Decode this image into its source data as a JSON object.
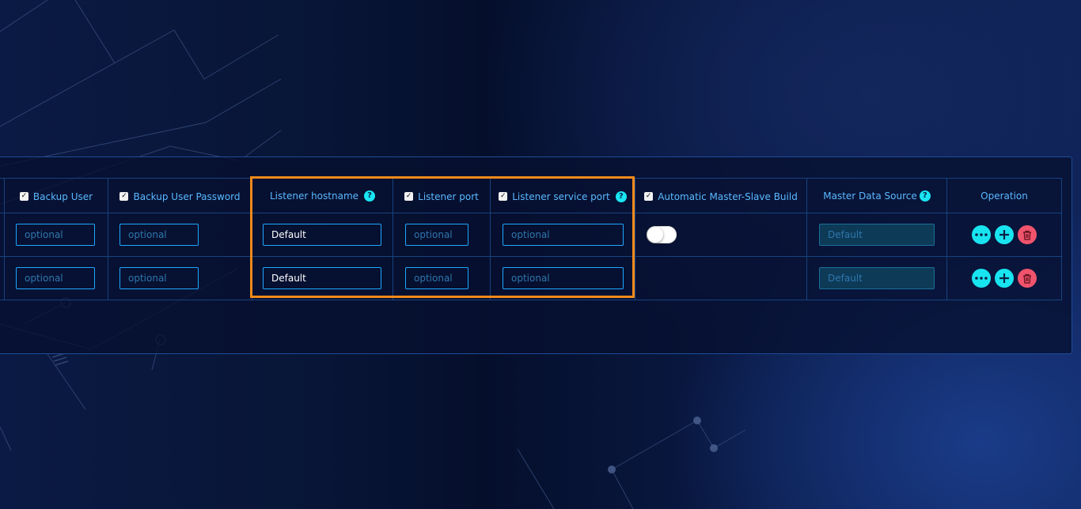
{
  "columns": [
    {
      "label": "Backup User",
      "checked": true
    },
    {
      "label": "Backup User Password",
      "checked": true
    },
    {
      "label": "Listener hostname",
      "help": true
    },
    {
      "label": "Listener port",
      "checked": true
    },
    {
      "label": "Listener service port",
      "checked": true,
      "help": true
    },
    {
      "label": "Automatic Master-Slave Build",
      "checked": true
    },
    {
      "label": "Master Data Source",
      "help": true
    },
    {
      "label": "Operation"
    }
  ],
  "rows": [
    {
      "backup_user_placeholder": "optional",
      "backup_password_placeholder": "optional",
      "listener_hostname": "Default",
      "listener_port_placeholder": "optional",
      "listener_service_port_placeholder": "optional",
      "auto_master_slave": false,
      "master_data_source_placeholder": "Default"
    },
    {
      "backup_user_placeholder": "optional",
      "backup_password_placeholder": "optional",
      "listener_hostname": "Default",
      "listener_port_placeholder": "optional",
      "listener_service_port_placeholder": "optional",
      "master_data_source_placeholder": "Default"
    }
  ],
  "icons": {
    "checkbox": "checkbox-checked-icon",
    "help": "question-circle-icon",
    "more": "more-dots-icon",
    "add": "plus-icon",
    "delete": "trash-icon"
  },
  "colors": {
    "header_text": "#5ab9ff",
    "input_border": "#1ea8ff",
    "accent_cyan": "#18e4f0",
    "delete_red": "#f0536c",
    "highlight_orange": "#f08a1a"
  }
}
